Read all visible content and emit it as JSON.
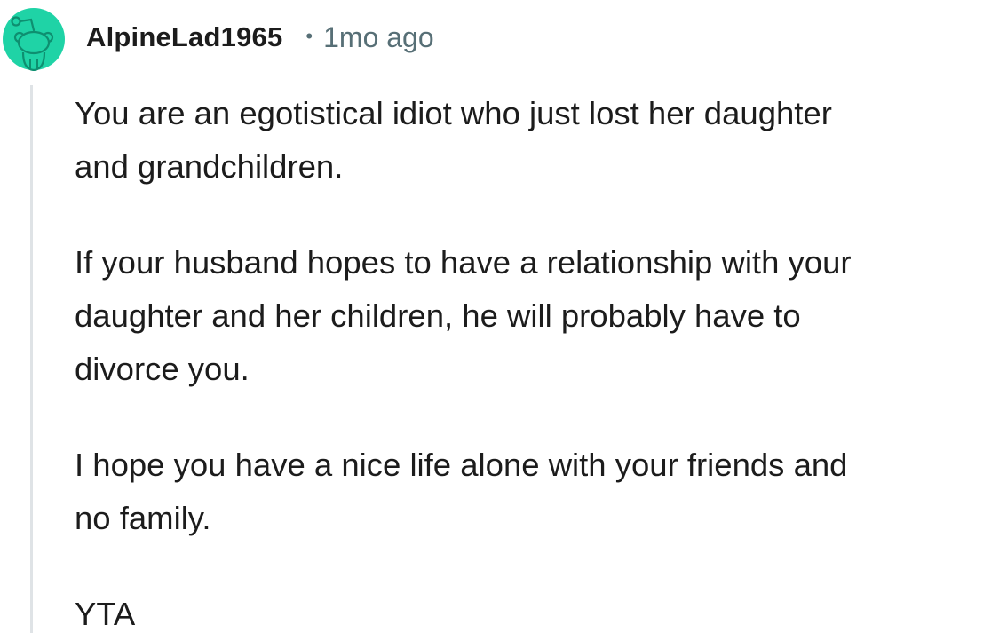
{
  "comment": {
    "avatar_icon": "reddit-snoo-avatar-icon",
    "avatar_color": "#1fd3a6",
    "username": "AlpineLad1965",
    "separator": "•",
    "timestamp": "1mo ago",
    "paragraphs": [
      {
        "lines": [
          "You are an egotistical idiot who just lost her daughter",
          "and grandchildren."
        ]
      },
      {
        "lines": [
          "If your husband hopes to have a relationship with your",
          "daughter and her children, he will probably have to",
          "divorce you."
        ]
      },
      {
        "lines": [
          "I hope you have a nice life alone with your friends and",
          "no family."
        ]
      },
      {
        "lines": [
          "YTA"
        ]
      }
    ]
  }
}
